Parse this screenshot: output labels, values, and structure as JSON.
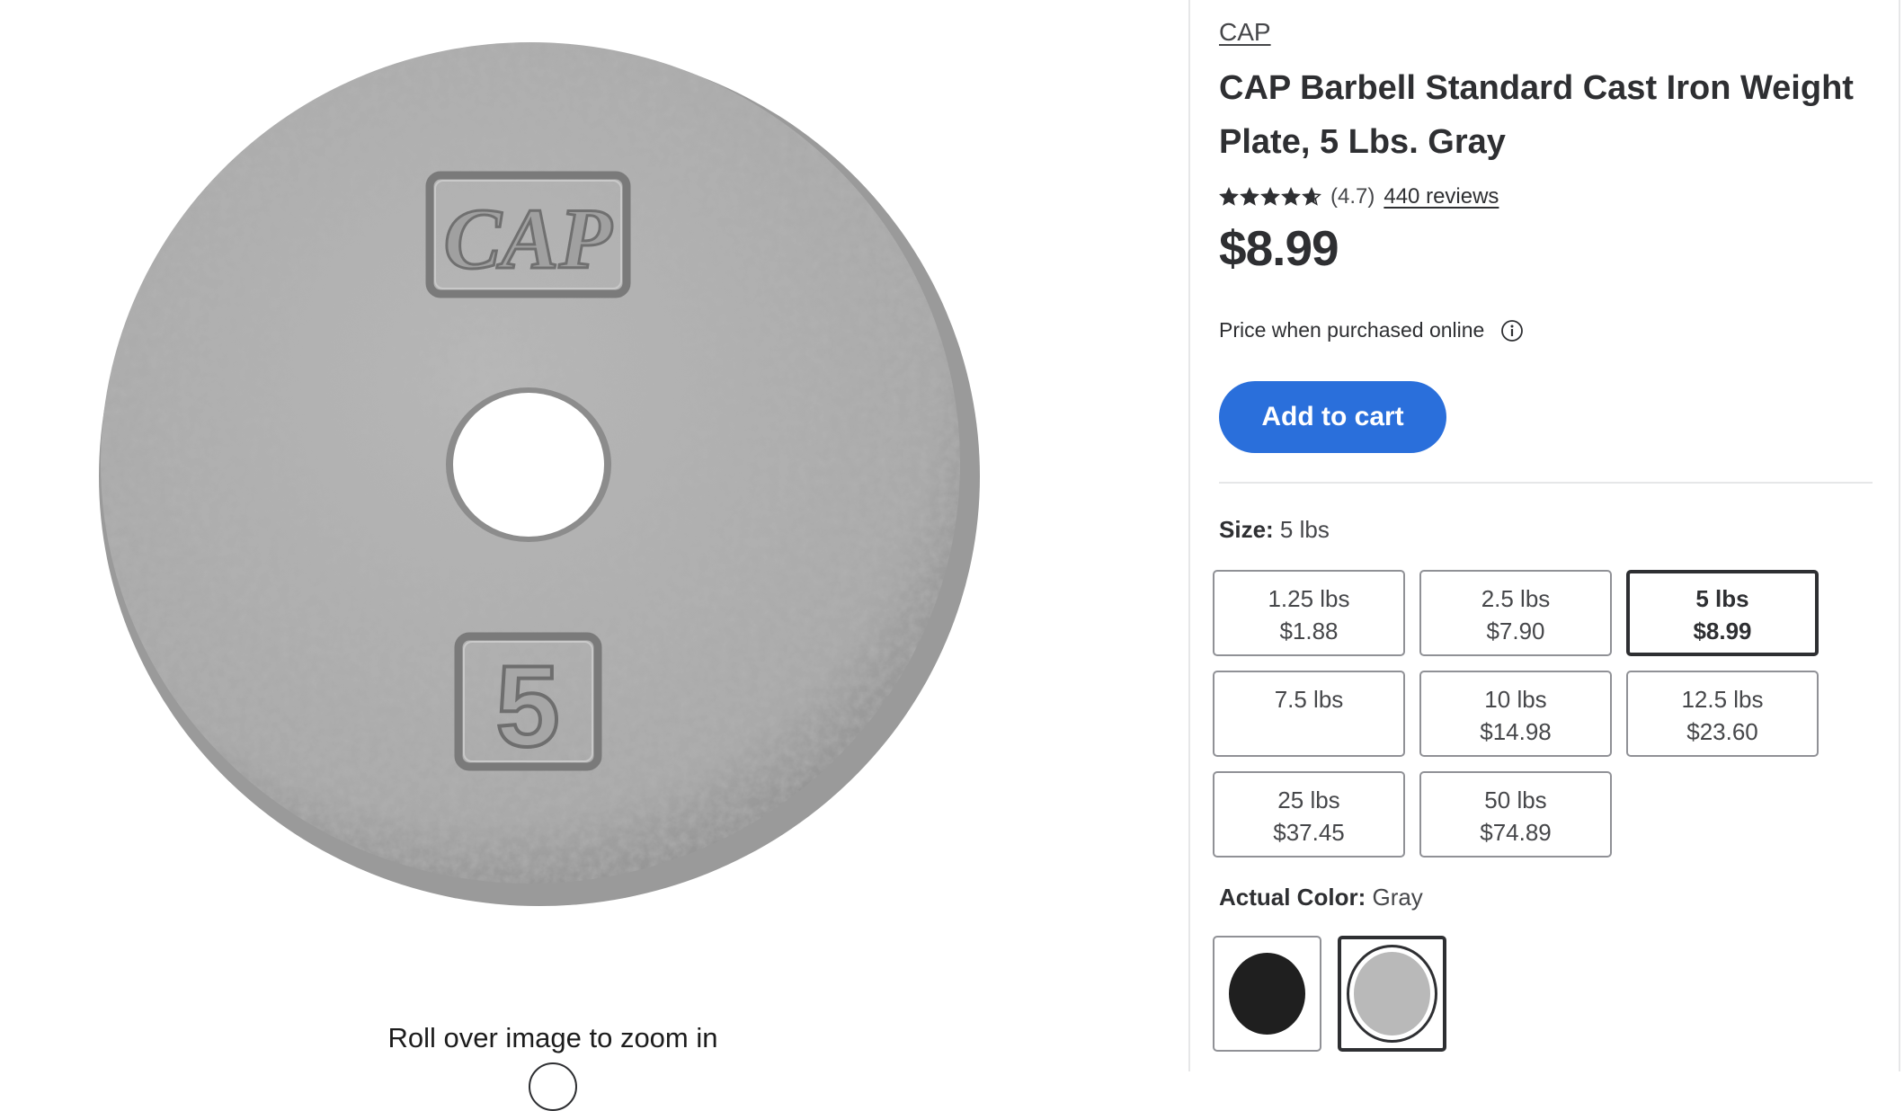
{
  "image_pane": {
    "plate_emboss_brand": "CAP",
    "plate_emboss_weight": "5",
    "zoom_hint": "Roll over image to zoom in"
  },
  "product": {
    "brand": "CAP",
    "title": "CAP Barbell Standard Cast Iron Weight Plate, 5 Lbs. Gray",
    "rating": 4.7,
    "rating_text": "(4.7)",
    "reviews_text": "440 reviews",
    "price": "$8.99",
    "price_note": "Price when purchased online",
    "add_to_cart_label": "Add to cart"
  },
  "size": {
    "label": "Size:",
    "selected": "5 lbs",
    "options": [
      {
        "size": "1.25 lbs",
        "price": "$1.88",
        "selected": false
      },
      {
        "size": "2.5 lbs",
        "price": "$7.90",
        "selected": false
      },
      {
        "size": "5 lbs",
        "price": "$8.99",
        "selected": true
      },
      {
        "size": "7.5 lbs",
        "price": "",
        "selected": false
      },
      {
        "size": "10 lbs",
        "price": "$14.98",
        "selected": false
      },
      {
        "size": "12.5 lbs",
        "price": "$23.60",
        "selected": false
      },
      {
        "size": "25 lbs",
        "price": "$37.45",
        "selected": false
      },
      {
        "size": "50 lbs",
        "price": "$74.89",
        "selected": false
      }
    ]
  },
  "color": {
    "label": "Actual Color:",
    "selected": "Gray",
    "swatches": [
      {
        "name": "black-swatch",
        "color": "#1f1f1f",
        "selected": false
      },
      {
        "name": "gray-swatch",
        "color": "#b9b9b9",
        "selected": true
      }
    ]
  },
  "colors": {
    "accent_blue": "#2a6fdb",
    "text_dark": "#2e2f32",
    "border_gray": "#909196"
  }
}
